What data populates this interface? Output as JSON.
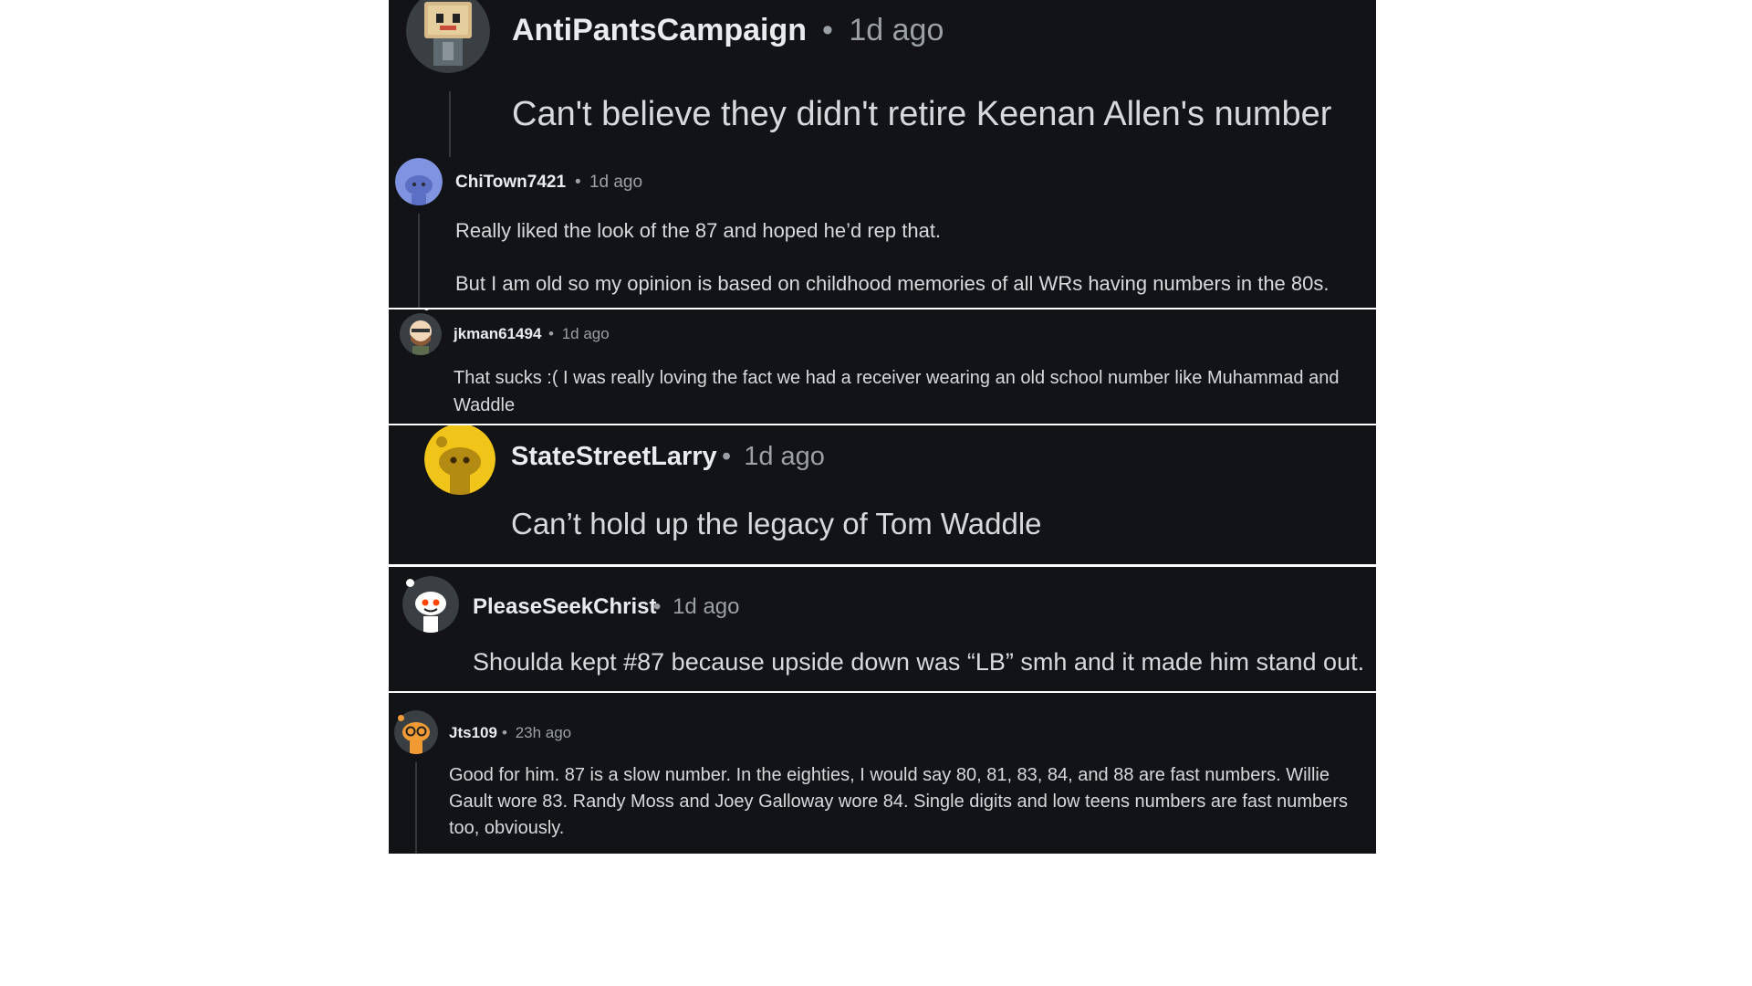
{
  "comments": [
    {
      "username": "AntiPantsCampaign",
      "separator": "•",
      "time": "1d ago",
      "text": "Can't believe they didn't retire Keenan Allen's number",
      "avatar": "robot-box-avatar-icon"
    },
    {
      "username": "ChiTown7421",
      "separator": "•",
      "time": "1d ago",
      "paragraphs": [
        "Really liked the look of the 87 and hoped he’d rep that.",
        "But I am old so my opinion is based on childhood memories of all WRs having numbers in the 80s."
      ],
      "avatar": "blue-snoo-avatar-icon"
    },
    {
      "username": "jkman61494",
      "separator": "•",
      "time": "1d ago",
      "text": "That sucks :( I was really loving the fact we had a receiver wearing an old school number like Muhammad and Waddle",
      "avatar": "bearded-snoo-avatar-icon"
    },
    {
      "username": "StateStreetLarry",
      "separator": "•",
      "time": "1d ago",
      "text": "Can’t hold up the legacy of Tom Waddle",
      "avatar": "yellow-snoo-avatar-icon"
    },
    {
      "username": "PleaseSeekChrist",
      "separator": "•",
      "time": "1d ago",
      "text": "Shoulda kept #87 because upside down was “LB” smh and it made him stand out.",
      "avatar": "white-snoo-avatar-icon"
    },
    {
      "username": "Jts109",
      "separator": "•",
      "time": "23h ago",
      "text": "Good for him. 87 is a slow number. In the eighties, I would say 80, 81, 83, 84, and 88 are fast numbers. Willie Gault wore 83. Randy Moss and Joey Galloway wore 84. Single digits and low teens numbers are fast numbers too, obviously.",
      "avatar": "orange-glasses-snoo-avatar-icon"
    }
  ],
  "colors": {
    "panel_bg": "#111316",
    "username": "#e9ecef",
    "meta": "#9aa0a6",
    "body": "#d7dadc",
    "thread_line": "#34383c"
  }
}
